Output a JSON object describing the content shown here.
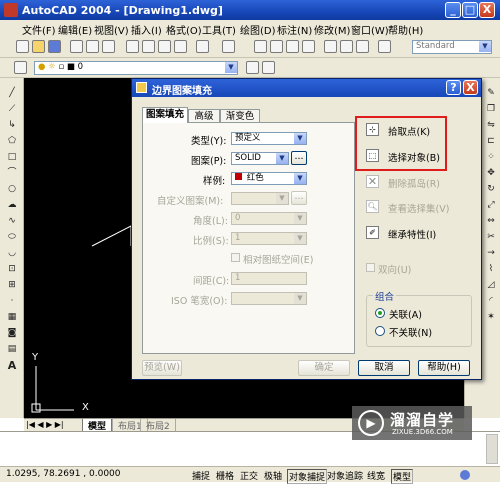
{
  "window": {
    "title": "AutoCAD 2004 - [Drawing1.dwg]",
    "min": "_",
    "max": "□",
    "close": "X"
  },
  "menu": [
    "文件(F)",
    "编辑(E)",
    "视图(V)",
    "插入(I)",
    "格式(O)",
    "工具(T)",
    "绘图(D)",
    "标注(N)",
    "修改(M)",
    "窗口(W)",
    "帮助(H)"
  ],
  "toolbar": {
    "layer_value": "0",
    "style_value": "Standard"
  },
  "dialog": {
    "title": "边界图案填充",
    "help": "?",
    "close": "X",
    "tabs": [
      "图案填充",
      "高级",
      "渐变色"
    ],
    "fields": {
      "type_label": "类型(Y):",
      "type_value": "预定义",
      "pattern_label": "图案(P):",
      "pattern_value": "SOLID",
      "sample_label": "样例:",
      "sample_value": "红色",
      "custom_label": "自定义图案(M):",
      "custom_value": "",
      "angle_label": "角度(L):",
      "angle_value": "0",
      "scale_label": "比例(S):",
      "scale_value": "1",
      "relative_label": "相对图纸空间(E)",
      "spacing_label": "间距(C):",
      "spacing_value": "1",
      "iso_label": "ISO 笔宽(O):",
      "iso_value": ""
    },
    "actions": {
      "pick_points": "拾取点(K)",
      "select_objects": "选择对象(B)",
      "remove_islands": "删除孤岛(R)",
      "view_selections": "查看选择集(V)",
      "inherit": "继承特性(I)"
    },
    "double_label": "双向(U)",
    "composition": {
      "title": "组合",
      "associative": "关联(A)",
      "nonassociative": "不关联(N)"
    },
    "buttons": {
      "preview": "预览(W)",
      "ok": "确定",
      "cancel": "取消",
      "help": "帮助(H)"
    },
    "sample_color": "#c00000"
  },
  "model_tabs": [
    "模型",
    "布局1",
    "布局2"
  ],
  "status": {
    "coords": "1.0295,  78.2691 , 0.0000",
    "modes": [
      "捕捉",
      "栅格",
      "正交",
      "极轴",
      "对象捕捉",
      "对象追踪",
      "线宽",
      "模型"
    ]
  },
  "ucs": {
    "y": "Y",
    "x": "X"
  },
  "watermark": {
    "brand": "溜溜自学",
    "url": "ZIXUE.3D66.COM"
  }
}
